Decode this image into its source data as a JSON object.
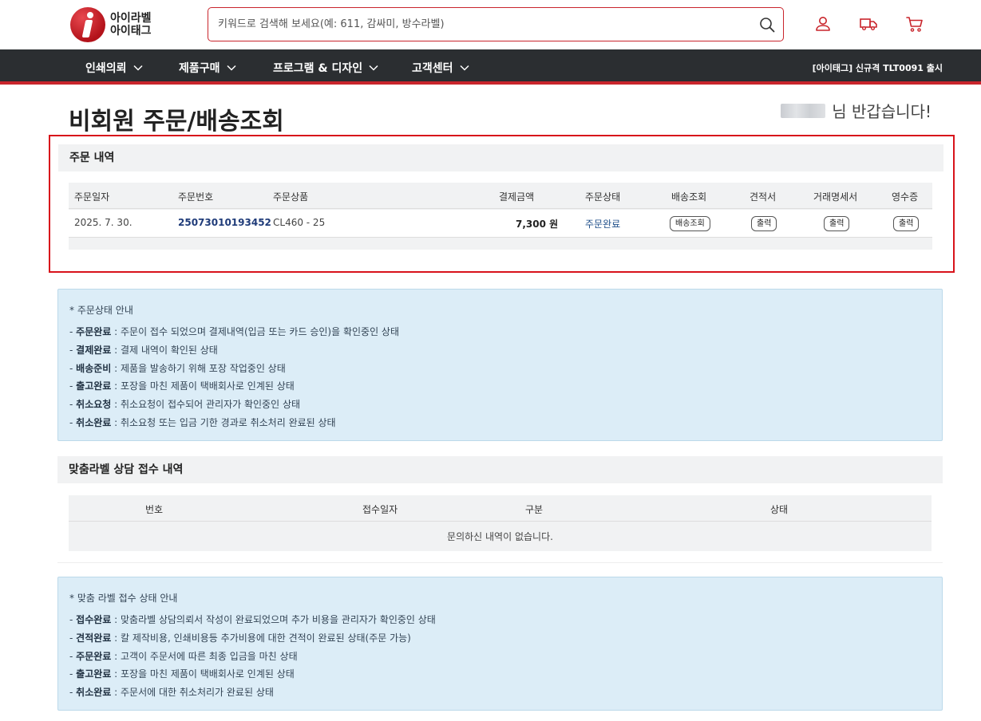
{
  "header": {
    "logo_line1": "아이라벨",
    "logo_line2": "아이태그",
    "search_placeholder": "키워드로 검색해 보세요(예: 611, 감싸미, 방수라벨)"
  },
  "nav": {
    "items": [
      {
        "label": "인쇄의뢰"
      },
      {
        "label": "제품구매"
      },
      {
        "label": "프로그램 & 디자인"
      },
      {
        "label": "고객센터"
      }
    ],
    "notice": "[아이태그] 신규격 TLT0091 출시"
  },
  "page": {
    "title": "비회원 주문/배송조회",
    "greeting": "님 반갑습니다!"
  },
  "orders": {
    "section_title": "주문 내역",
    "columns": [
      "주문일자",
      "주문번호",
      "주문상품",
      "결제금액",
      "주문상태",
      "배송조회",
      "견적서",
      "거래명세서",
      "영수증"
    ],
    "rows": [
      {
        "date": "2025. 7. 30.",
        "order_no": "25073010193452",
        "product": "CL460 - 25",
        "amount": "7,300 원",
        "status": "주문완료",
        "track_label": "배송조회",
        "quote_label": "출력",
        "invoice_label": "출력",
        "receipt_label": "출력"
      }
    ]
  },
  "order_status_guide": {
    "title": "* 주문상태 안내",
    "items": [
      {
        "term": "주문완료",
        "desc": " : 주문이 접수 되었으며 결제내역(입금 또는 카드 승인)을 확인중인 상태"
      },
      {
        "term": "결제완료",
        "desc": " : 결제 내역이 확인된 상태"
      },
      {
        "term": "배송준비",
        "desc": " : 제품을 발송하기 위해 포장 작업중인 상태"
      },
      {
        "term": "출고완료",
        "desc": " : 포장을 마친 제품이 택배회사로 인계된 상태"
      },
      {
        "term": "취소요청",
        "desc": " : 취소요청이 접수되어 관리자가 확인중인 상태"
      },
      {
        "term": "취소완료",
        "desc": " : 취소요청 또는 입금 기한 경과로 취소처리 완료된 상태"
      }
    ]
  },
  "consult": {
    "section_title": "맞춤라벨 상담 접수 내역",
    "columns": [
      "번호",
      "접수일자",
      "구분",
      "상태"
    ],
    "empty_text": "문의하신 내역이 없습니다."
  },
  "consult_status_guide": {
    "title": "* 맞춤 라벨 접수 상태 안내",
    "items": [
      {
        "term": "접수완료",
        "desc": " : 맞춤라벨 상담의뢰서 작성이 완료되었으며 추가 비용을 관리자가 확인중인 상태"
      },
      {
        "term": "견적완료",
        "desc": " : 칼 제작비용, 인쇄비용등 추가비용에 대한 견적이 완료된 상태(주문 가능)"
      },
      {
        "term": "주문완료",
        "desc": " : 고객이 주문서에 따른 최종 입금을 마친 상태"
      },
      {
        "term": "출고완료",
        "desc": " : 포장을 마친 제품이 택배회사로 인계된 상태"
      },
      {
        "term": "취소완료",
        "desc": " : 주문서에 대한 취소처리가 완료된 상태"
      }
    ]
  },
  "colors": {
    "brand_red": "#c9252c",
    "nav_bg": "#2b2e31",
    "info_bg": "#dcedf7",
    "link_blue": "#1f3b79"
  }
}
